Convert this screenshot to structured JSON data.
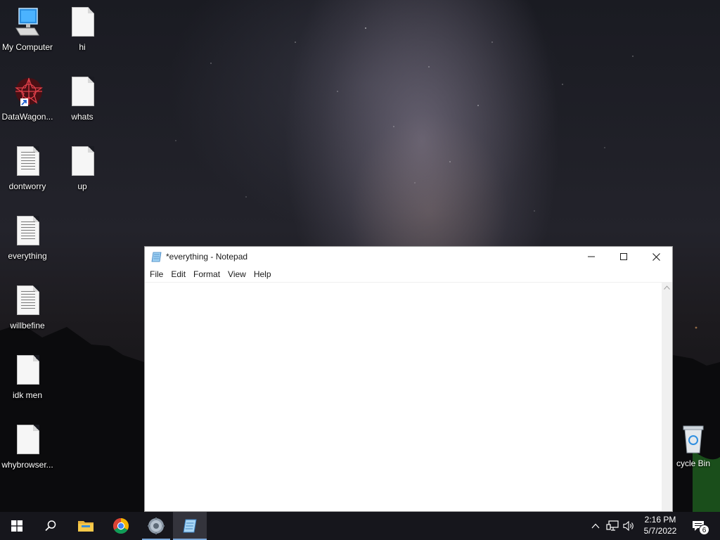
{
  "desktop": {
    "icons": [
      {
        "label": "My Computer"
      },
      {
        "label": "hi"
      },
      {
        "label": "DataWagon..."
      },
      {
        "label": "whats"
      },
      {
        "label": "dontworry"
      },
      {
        "label": "up"
      },
      {
        "label": "everything"
      },
      {
        "label": "willbefine"
      },
      {
        "label": "idk men"
      },
      {
        "label": "whybrowser..."
      }
    ],
    "recycle_bin_label": "cycle Bin"
  },
  "notepad": {
    "title": "*everything - Notepad",
    "menu": [
      "File",
      "Edit",
      "Format",
      "View",
      "Help"
    ],
    "content": ""
  },
  "taskbar": {
    "time": "2:16 PM",
    "date": "5/7/2022",
    "notification_count": "6"
  },
  "colors": {
    "taskbar_bg": "#16161c",
    "active_indicator": "#7aa7d9",
    "window_bg": "#ffffff"
  }
}
